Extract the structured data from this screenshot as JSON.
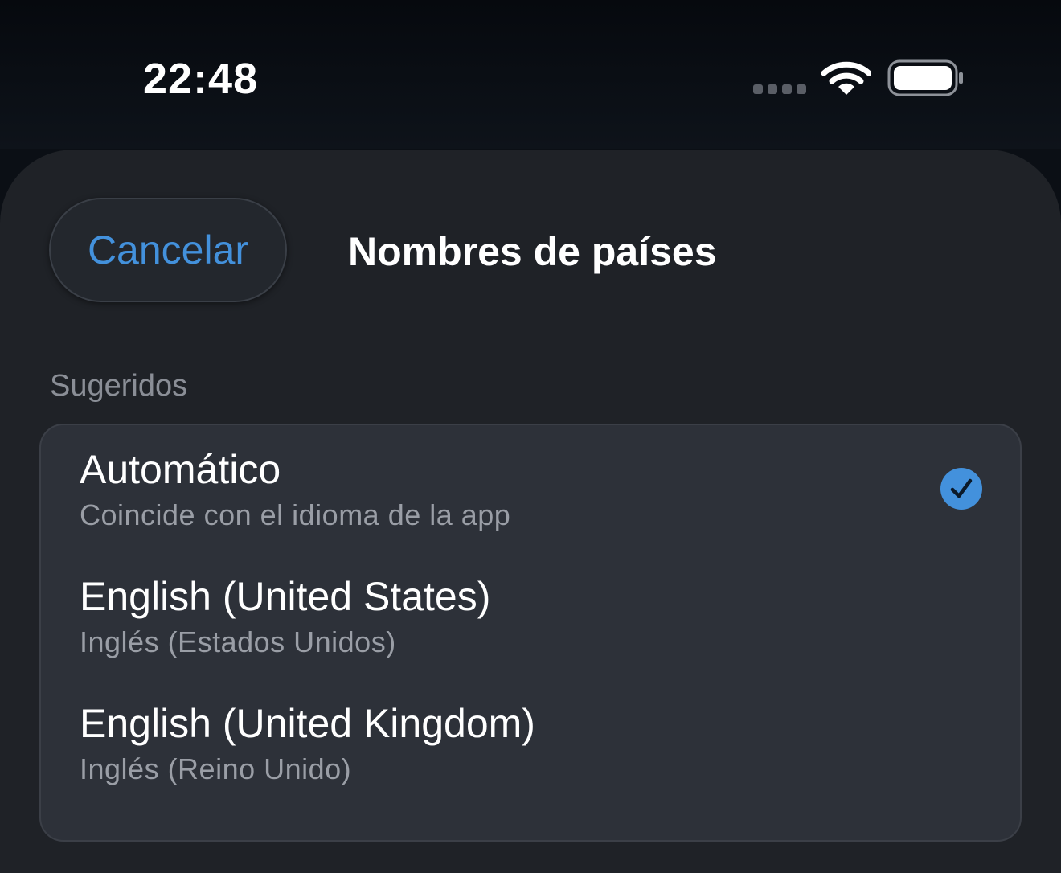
{
  "status_bar": {
    "time": "22:48",
    "icons": [
      "signal-icon",
      "wifi-icon",
      "battery-icon"
    ]
  },
  "header": {
    "cancel_label": "Cancelar",
    "title": "Nombres de países"
  },
  "section": {
    "header": "Sugeridos"
  },
  "items": [
    {
      "title": "Automático",
      "subtitle": "Coincide con el idioma de la app",
      "selected": true
    },
    {
      "title": "English (United States)",
      "subtitle": "Inglés (Estados Unidos)",
      "selected": false
    },
    {
      "title": "English (United Kingdom)",
      "subtitle": "Inglés (Reino Unido)",
      "selected": false
    }
  ],
  "colors": {
    "accent": "#4391dc",
    "sheet_background": "#1f2227",
    "card_background": "#2d3139"
  }
}
